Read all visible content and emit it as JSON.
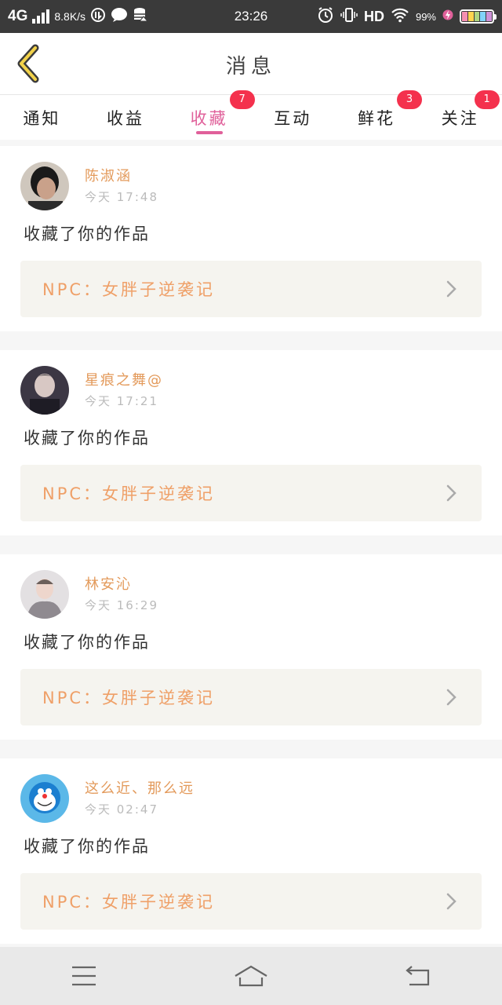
{
  "status_bar": {
    "network": "4G",
    "speed": "8.8K/s",
    "time": "23:26",
    "hd": "HD",
    "battery_pct": "99%",
    "icons": [
      "signal-icon",
      "data-saver-icon",
      "chat-icon",
      "database-icon",
      "alarm-icon",
      "vibrate-icon",
      "wifi-icon",
      "battery-icon"
    ]
  },
  "header": {
    "title": "消息",
    "back_icon": "chevron-left-icon"
  },
  "tabs": [
    {
      "label": "通知",
      "badge": ""
    },
    {
      "label": "收益",
      "badge": ""
    },
    {
      "label": "收藏",
      "badge": "7",
      "active": true
    },
    {
      "label": "互动",
      "badge": ""
    },
    {
      "label": "鲜花",
      "badge": "3"
    },
    {
      "label": "关注",
      "badge": "1"
    }
  ],
  "messages": [
    {
      "user": "陈淑涵",
      "time": "今天 17:48",
      "action": "收藏了你的作品",
      "work": "NPC：女胖子逆袭记"
    },
    {
      "user": "星痕之舞@",
      "time": "今天 17:21",
      "action": "收藏了你的作品",
      "work": "NPC：女胖子逆袭记"
    },
    {
      "user": "林安沁",
      "time": "今天 16:29",
      "action": "收藏了你的作品",
      "work": "NPC：女胖子逆袭记"
    },
    {
      "user": "这么近、那么远",
      "time": "今天 02:47",
      "action": "收藏了你的作品",
      "work": "NPC：女胖子逆袭记"
    }
  ],
  "colors": {
    "accent": "#e0609a",
    "badge": "#f4314d",
    "username": "#e39a5b",
    "work_title": "#efa068",
    "work_bg": "#f5f4ef"
  },
  "nav": {
    "icons": [
      "menu-icon",
      "home-icon",
      "back-icon"
    ]
  }
}
